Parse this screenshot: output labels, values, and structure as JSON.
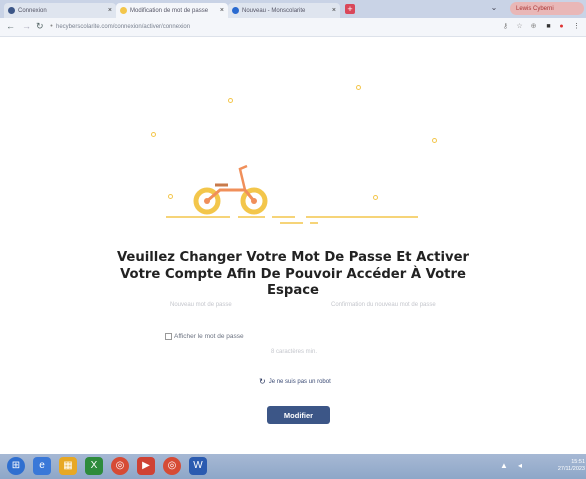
{
  "browser": {
    "tabs": [
      {
        "label": "Connexion",
        "active": false
      },
      {
        "label": "Modification de mot de passe",
        "active": true
      },
      {
        "label": "Nouveau - Monscolarite",
        "active": false
      }
    ],
    "new_tab": "+",
    "user": "Lewis Cyberni",
    "url": "hecyberscolarite.com/connexion/activer/connexion"
  },
  "page": {
    "heading": "Veuillez Changer Votre Mot De Passe Et Activer Votre Compte Afin De Pouvoir Accéder À Votre Espace",
    "label_new_password": "Nouveau mot de passe",
    "label_confirm_password": "Confirmation du nouveau mot de passe",
    "label_show_password": "Afficher le mot de passe",
    "label_min_chars": "8 caractères min.",
    "captcha_label": "Je ne suis pas un robot",
    "submit_label": "Modifier"
  },
  "taskbar": {
    "time": "15:51",
    "date": "27/11/2023"
  },
  "colors": {
    "accent_button": "#3c5687",
    "illustration_yellow": "#f3c64b",
    "bike_frame": "#f08f5a"
  }
}
